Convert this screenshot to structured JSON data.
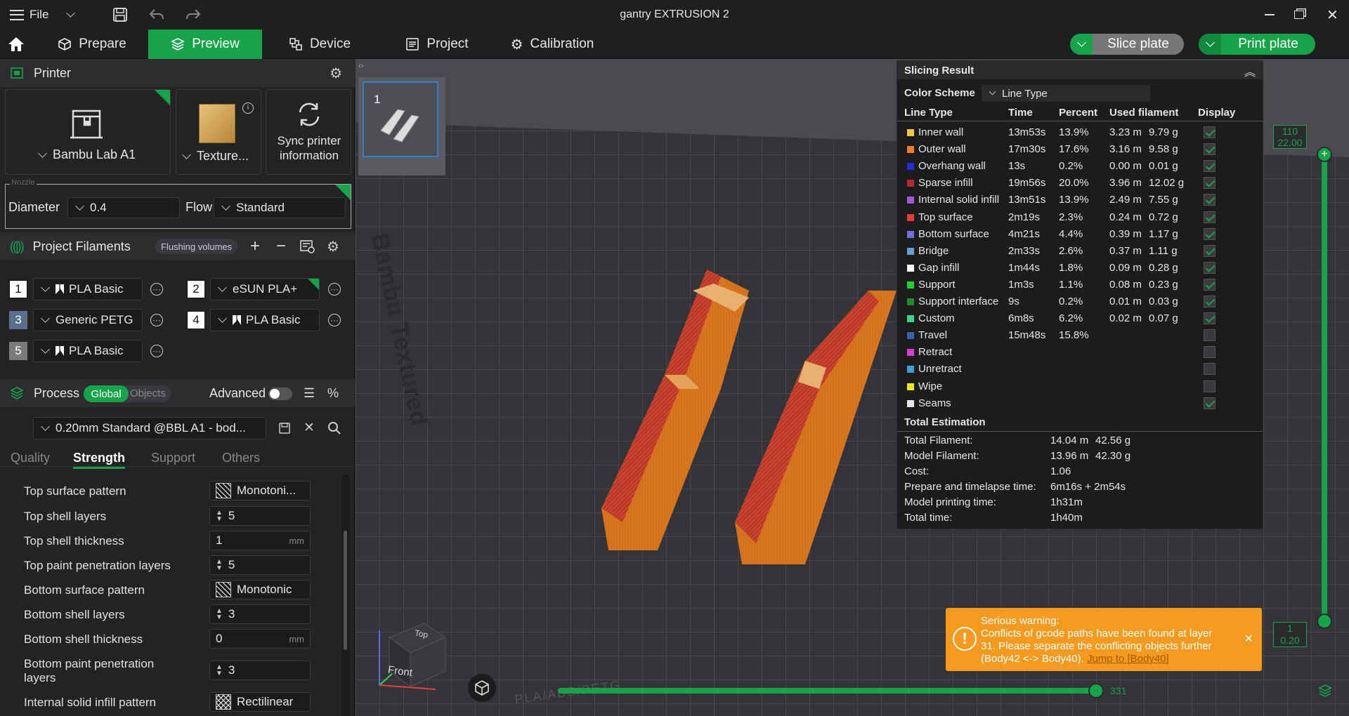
{
  "titlebar": {
    "file_label": "File",
    "title": "gantry EXTRUSION 2"
  },
  "tabs": {
    "prepare": "Prepare",
    "preview": "Preview",
    "device": "Device",
    "project": "Project",
    "calibration": "Calibration"
  },
  "actions": {
    "slice": "Slice plate",
    "print": "Print plate"
  },
  "printer": {
    "section_title": "Printer",
    "model": "Bambu Lab A1",
    "plate": "Texture...",
    "sync_line1": "Sync printer",
    "sync_line2": "information",
    "nozzle_legend": "Nozzle",
    "diameter_label": "Diameter",
    "diameter_value": "0.4",
    "flow_label": "Flow",
    "flow_value": "Standard"
  },
  "filaments": {
    "section_title": "Project Filaments",
    "flushing_label": "Flushing volumes",
    "items": [
      {
        "num": "1",
        "name": "PLA Basic",
        "color": "#ffffff"
      },
      {
        "num": "2",
        "name": "eSUN PLA+",
        "color": "#ffffff"
      },
      {
        "num": "3",
        "name": "Generic PETG",
        "color": "#5a6f8e"
      },
      {
        "num": "4",
        "name": "PLA Basic",
        "color": "#ffffff"
      },
      {
        "num": "5",
        "name": "PLA Basic",
        "color": "#7a7a7a"
      }
    ]
  },
  "process": {
    "section_title": "Process",
    "global_label": "Global",
    "objects_label": "Objects",
    "advanced_label": "Advanced",
    "preset": "0.20mm Standard @BBL A1 - bod...",
    "tabs": [
      "Quality",
      "Strength",
      "Support",
      "Others"
    ],
    "params": [
      {
        "label": "Top surface pattern",
        "value": "Monotoni...",
        "type": "pattern"
      },
      {
        "label": "Top shell layers",
        "value": "5",
        "type": "spin"
      },
      {
        "label": "Top shell thickness",
        "value": "1",
        "unit": "mm",
        "type": "unit"
      },
      {
        "label": "Top paint penetration layers",
        "value": "5",
        "type": "spin"
      },
      {
        "label": "Bottom surface pattern",
        "value": "Monotonic",
        "type": "pattern"
      },
      {
        "label": "Bottom shell layers",
        "value": "3",
        "type": "spin"
      },
      {
        "label": "Bottom shell thickness",
        "value": "0",
        "unit": "mm",
        "type": "unit"
      },
      {
        "label": "Bottom paint penetration",
        "label2": "layers",
        "value": "3",
        "type": "spin"
      },
      {
        "label": "Internal solid infill pattern",
        "value": "Rectilinear",
        "type": "pattern"
      }
    ]
  },
  "plate_thumb": {
    "num": "1"
  },
  "bed_text": "Bambu Textured",
  "bed_text_bottom": "PLA/ABS/PETG",
  "slicing": {
    "title": "Slicing Result",
    "color_scheme_label": "Color Scheme",
    "color_scheme_value": "Line Type",
    "headers": {
      "type": "Line Type",
      "time": "Time",
      "percent": "Percent",
      "used": "Used filament",
      "display": "Display"
    },
    "rows": [
      {
        "name": "Inner wall",
        "color": "#f5c542",
        "time": "13m53s",
        "percent": "13.9%",
        "m": "3.23 m",
        "g": "9.79 g",
        "on": true
      },
      {
        "name": "Outer wall",
        "color": "#f07b2e",
        "time": "17m30s",
        "percent": "17.6%",
        "m": "3.16 m",
        "g": "9.58 g",
        "on": true
      },
      {
        "name": "Overhang wall",
        "color": "#1f2fe0",
        "time": "13s",
        "percent": "0.2%",
        "m": "0.00 m",
        "g": "0.01 g",
        "on": true
      },
      {
        "name": "Sparse infill",
        "color": "#b52b2b",
        "time": "19m56s",
        "percent": "20.0%",
        "m": "3.96 m",
        "g": "12.02 g",
        "on": true
      },
      {
        "name": "Internal solid infill",
        "color": "#a259d9",
        "time": "13m51s",
        "percent": "13.9%",
        "m": "2.49 m",
        "g": "7.55 g",
        "on": true
      },
      {
        "name": "Top surface",
        "color": "#e63b3b",
        "time": "2m19s",
        "percent": "2.3%",
        "m": "0.24 m",
        "g": "0.72 g",
        "on": true
      },
      {
        "name": "Bottom surface",
        "color": "#6e6ee0",
        "time": "4m21s",
        "percent": "4.4%",
        "m": "0.39 m",
        "g": "1.17 g",
        "on": true
      },
      {
        "name": "Bridge",
        "color": "#6b9ad6",
        "time": "2m33s",
        "percent": "2.6%",
        "m": "0.37 m",
        "g": "1.11 g",
        "on": true
      },
      {
        "name": "Gap infill",
        "color": "#ffffff",
        "time": "1m44s",
        "percent": "1.8%",
        "m": "0.09 m",
        "g": "0.28 g",
        "on": true
      },
      {
        "name": "Support",
        "color": "#1fd12f",
        "time": "1m3s",
        "percent": "1.1%",
        "m": "0.08 m",
        "g": "0.23 g",
        "on": true
      },
      {
        "name": "Support interface",
        "color": "#1f8a2a",
        "time": "9s",
        "percent": "0.2%",
        "m": "0.01 m",
        "g": "0.03 g",
        "on": true
      },
      {
        "name": "Custom",
        "color": "#3fcf8a",
        "time": "6m8s",
        "percent": "6.2%",
        "m": "0.02 m",
        "g": "0.07 g",
        "on": true
      },
      {
        "name": "Travel",
        "color": "#3c5fa8",
        "time": "15m48s",
        "percent": "15.8%",
        "m": "",
        "g": "",
        "on": false
      },
      {
        "name": "Retract",
        "color": "#d43fd4",
        "time": "",
        "percent": "",
        "m": "",
        "g": "",
        "on": false
      },
      {
        "name": "Unretract",
        "color": "#3aa0d6",
        "time": "",
        "percent": "",
        "m": "",
        "g": "",
        "on": false
      },
      {
        "name": "Wipe",
        "color": "#f2e51a",
        "time": "",
        "percent": "",
        "m": "",
        "g": "",
        "on": false
      },
      {
        "name": "Seams",
        "color": "#e6e6e6",
        "time": "",
        "percent": "",
        "m": "",
        "g": "",
        "on": true
      }
    ],
    "total_title": "Total Estimation",
    "totals": [
      {
        "label": "Total Filament:",
        "value": "14.04 m",
        "value2": "42.56 g"
      },
      {
        "label": "Model Filament:",
        "value": "13.96 m",
        "value2": "42.30 g"
      },
      {
        "label": "Cost:",
        "value": "1.06",
        "value2": ""
      },
      {
        "label": "Prepare and timelapse time:",
        "value": "6m16s + 2m54s",
        "value2": ""
      },
      {
        "label": "Model printing time:",
        "value": "1h31m",
        "value2": ""
      },
      {
        "label": "Total time:",
        "value": "1h40m",
        "value2": ""
      }
    ]
  },
  "layer_slider": {
    "top_layer": "110",
    "top_height": "22.00",
    "bottom_layer": "1",
    "bottom_height": "0.20"
  },
  "move_slider": {
    "value": "331"
  },
  "nav_cube": {
    "top": "Top",
    "front": "Front"
  },
  "warning": {
    "title": "Serious warning:",
    "line1": "Conflicts of gcode paths have been found at layer",
    "line2": "31. Please separate the conflicting objects further",
    "line3": "(Body42 <-> Body40).",
    "link": "Jump to [Body40]"
  },
  "colors": {
    "accent": "#17a34a",
    "warning": "#f49a1f",
    "model": "#e07a1f"
  }
}
